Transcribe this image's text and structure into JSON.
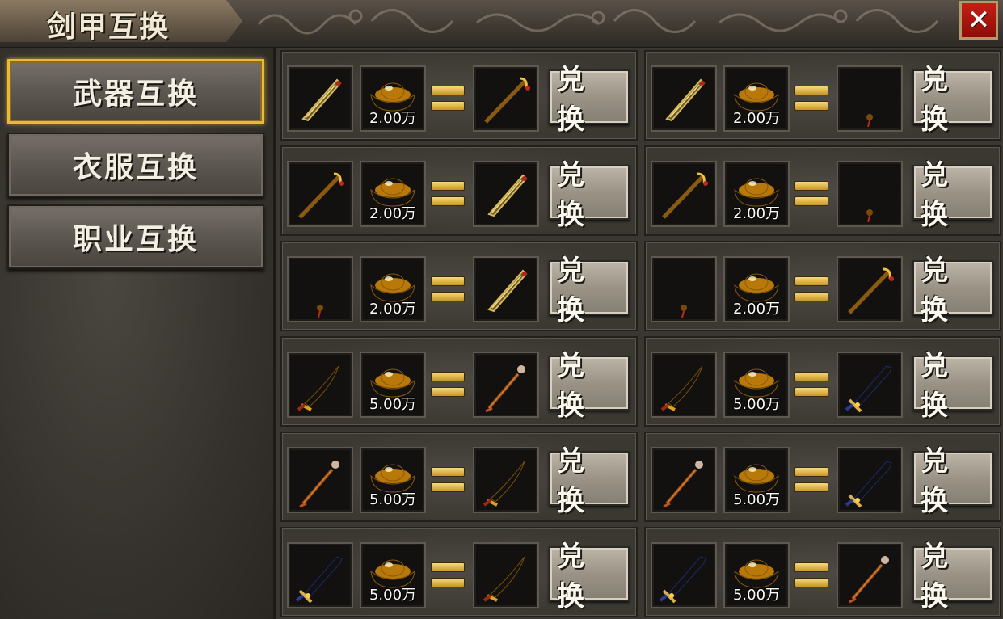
{
  "window": {
    "title": "剑甲互换",
    "close_label": "✕"
  },
  "sidebar": {
    "items": [
      {
        "label": "武器互换",
        "active": true
      },
      {
        "label": "衣服互换",
        "active": false
      },
      {
        "label": "职业互换",
        "active": false
      }
    ]
  },
  "exchange_button_label": "兑 换",
  "cost_icon": "gold-ingot-icon",
  "rows": [
    [
      {
        "from": "dark-sword-icon",
        "price": "2.00万",
        "to": "golden-staff-icon"
      },
      {
        "from": "dark-sword-icon",
        "price": "2.00万",
        "to": "golden-fan-icon"
      }
    ],
    [
      {
        "from": "golden-staff-icon",
        "price": "2.00万",
        "to": "dark-sword-icon"
      },
      {
        "from": "golden-staff-icon",
        "price": "2.00万",
        "to": "golden-fan-icon"
      }
    ],
    [
      {
        "from": "golden-fan-icon",
        "price": "2.00万",
        "to": "dark-sword-icon"
      },
      {
        "from": "golden-fan-icon",
        "price": "2.00万",
        "to": "golden-staff-icon"
      }
    ],
    [
      {
        "from": "golden-saber-icon",
        "price": "5.00万",
        "to": "flame-staff-icon"
      },
      {
        "from": "golden-saber-icon",
        "price": "5.00万",
        "to": "blue-greatsword-icon"
      }
    ],
    [
      {
        "from": "flame-staff-icon",
        "price": "5.00万",
        "to": "golden-saber-icon"
      },
      {
        "from": "flame-staff-icon",
        "price": "5.00万",
        "to": "blue-greatsword-icon"
      }
    ],
    [
      {
        "from": "blue-greatsword-icon",
        "price": "5.00万",
        "to": "golden-saber-icon"
      },
      {
        "from": "blue-greatsword-icon",
        "price": "5.00万",
        "to": "flame-staff-icon"
      }
    ]
  ]
}
